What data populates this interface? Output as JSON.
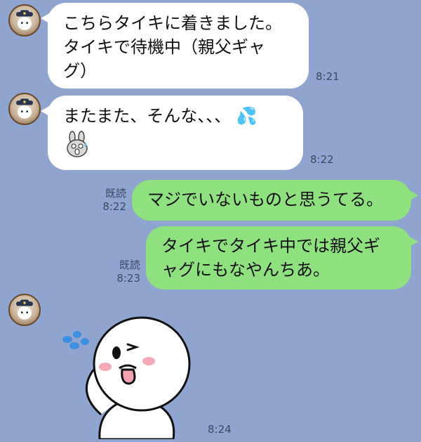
{
  "messages": [
    {
      "lines": [
        "こちらタイキに着きました。",
        "タイキで待機中（親父ギャ",
        "グ）"
      ],
      "time": "8:21"
    },
    {
      "text": "またまた、そんな、、、",
      "emoji": "💦",
      "time": "8:22"
    },
    {
      "text": "マジでいないものと思うてる。",
      "read": "既読",
      "time": "8:22"
    },
    {
      "lines": [
        "タイキでタイキ中では親父ギ",
        "ャグにもなやんちあ。"
      ],
      "read": "既読",
      "time": "8:23"
    },
    {
      "sticker": "wink-sticker",
      "time": "8:24"
    }
  ],
  "colors": {
    "background": "#8FA5D0",
    "incoming_bubble": "#FFFFFF",
    "outgoing_bubble": "#8FE07F"
  },
  "icons": [
    "captain-avatar-icon",
    "sweat-drops-icon",
    "bunny-sticker-icon",
    "wink-sticker-icon"
  ]
}
